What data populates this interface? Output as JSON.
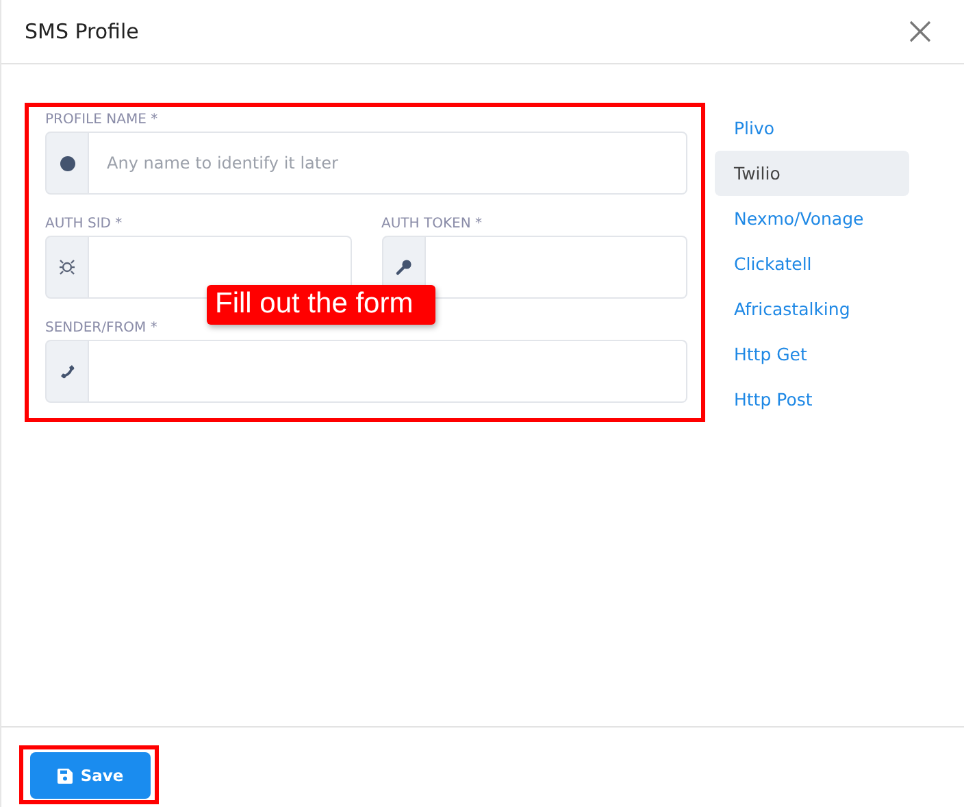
{
  "dialog": {
    "title": "SMS Profile"
  },
  "form_rows": [
    [
      {
        "label": "PROFILE NAME *",
        "placeholder": "Any name to identify it later"
      }
    ],
    [
      {
        "label": "AUTH SID *"
      },
      {
        "label": "AUTH TOKEN *"
      }
    ],
    [
      {
        "label": "SENDER/FROM *"
      }
    ]
  ],
  "callout": "Fill out the form",
  "providers": [
    {
      "label": "Plivo",
      "selected": false
    },
    {
      "label": "Twilio",
      "selected": true
    },
    {
      "label": "Nexmo/Vonage",
      "selected": false
    },
    {
      "label": "Clickatell",
      "selected": false
    },
    {
      "label": "Africastalking",
      "selected": false
    },
    {
      "label": "Http Get",
      "selected": false
    },
    {
      "label": "Http Post",
      "selected": false
    }
  ],
  "save_button": {
    "label": "Save"
  }
}
